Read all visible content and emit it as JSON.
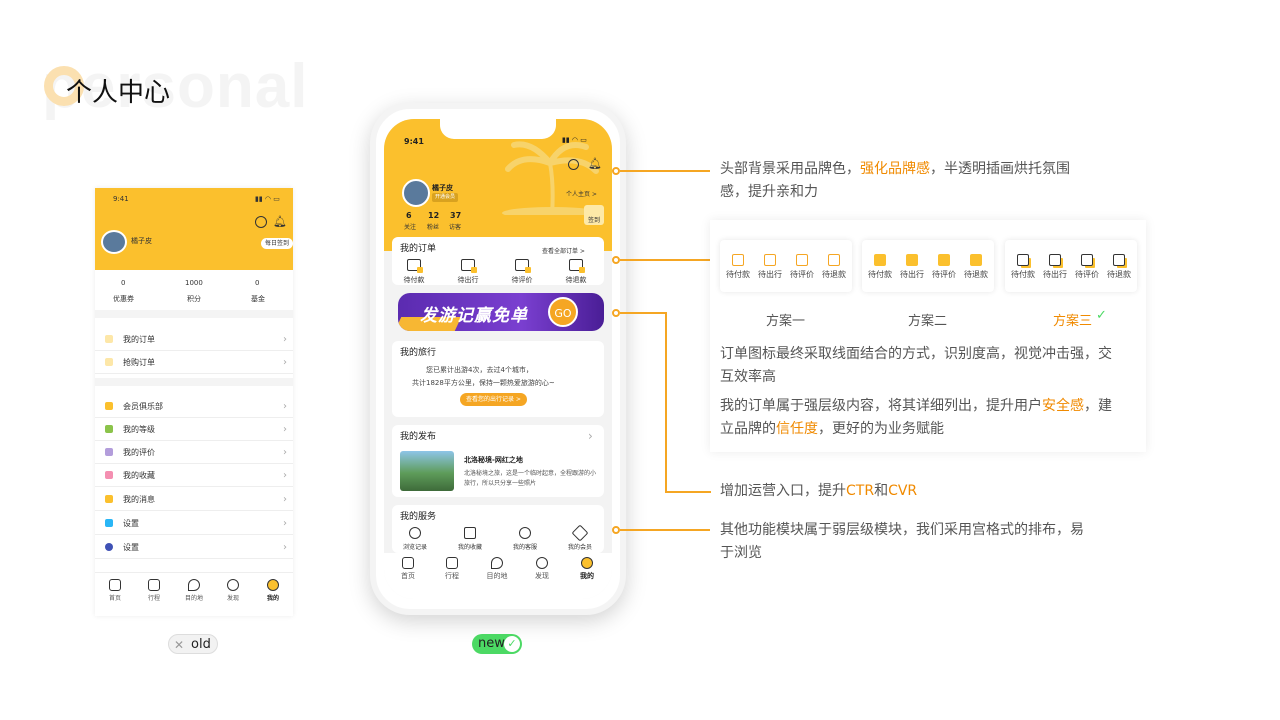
{
  "header": {
    "watermark": "personal",
    "title": "个人中心"
  },
  "old": {
    "time": "9:41",
    "username": "橘子皮",
    "checkin": "每日签到",
    "stats": [
      {
        "value": "0",
        "label": "优惠券"
      },
      {
        "value": "1000",
        "label": "积分"
      },
      {
        "value": "0",
        "label": "基金"
      }
    ],
    "rows1": [
      "我的订单",
      "抢购订单"
    ],
    "rows2": [
      "会员俱乐部",
      "我的等级",
      "我的评价",
      "我的收藏",
      "我的消息",
      "设置",
      "设置"
    ],
    "tabs": [
      "首页",
      "行程",
      "目的地",
      "发现",
      "我的"
    ],
    "tag": "old"
  },
  "new": {
    "time": "9:41",
    "username": "橘子皮",
    "member": "开通会员",
    "homepage": "个人主页 >",
    "signin": "签到",
    "stats": [
      {
        "value": "6",
        "label": "关注"
      },
      {
        "value": "12",
        "label": "粉丝"
      },
      {
        "value": "37",
        "label": "访客"
      }
    ],
    "orders": {
      "title": "我的订单",
      "all": "查看全部订单 >",
      "items": [
        "待付款",
        "待出行",
        "待评价",
        "待退款"
      ]
    },
    "banner": {
      "text": "发游记赢免单",
      "go": "GO"
    },
    "trip": {
      "title": "我的旅行",
      "line1": "您已累计出游4次，去过4个城市，",
      "line2": "共计1828平方公里，保持一颗热爱旅游的心~",
      "btn": "查看您的出行记录 >"
    },
    "publish": {
      "title": "我的发布",
      "post_title": "北洛秘境-网红之地",
      "post_body": "北洛秘境之旅，这是一个临时起意，全程跟游的小旅行，所以只分享一些照片"
    },
    "services": {
      "title": "我的服务",
      "items": [
        "浏览记录",
        "我的收藏",
        "我的客服",
        "我的会员"
      ]
    },
    "tabs": [
      "首页",
      "行程",
      "目的地",
      "发现",
      "我的"
    ],
    "tag": "new"
  },
  "annotations": {
    "a1_pre": "头部背景采用品牌色，",
    "a1_hl": "强化品牌感",
    "a1_post": "，半透明插画烘托氛围",
    "a1_line2": "感，提升亲和力",
    "schemes": [
      {
        "label": "方案一",
        "items": [
          "待付款",
          "待出行",
          "待评价",
          "待退款"
        ]
      },
      {
        "label": "方案二",
        "items": [
          "待付款",
          "待出行",
          "待评价",
          "待退款"
        ]
      },
      {
        "label": "方案三",
        "items": [
          "待付款",
          "待出行",
          "待评价",
          "待退款"
        ]
      }
    ],
    "p1_l1": "订单图标最终采取线面结合的方式，识别度高，视觉冲击强，交",
    "p1_l2": "互效率高",
    "p2_l1_pre": "我的订单属于强层级内容，将其详细列出，提升用户",
    "p2_l1_hl": "安全感",
    "p2_l1_post": "，建",
    "p2_l2_pre": "立品牌的",
    "p2_l2_hl": "信任度",
    "p2_l2_post": "，更好的为业务赋能",
    "a3_pre": "增加运营入口，提升",
    "a3_hl1": "CTR",
    "a3_mid": "和",
    "a3_hl2": "CVR",
    "a4_l1": "其他功能模块属于弱层级模块，我们采用宫格式的排布，易",
    "a4_l2": "于浏览"
  },
  "colors": {
    "brand": "#fbc02d",
    "accent": "#f08a00",
    "check": "#4cd964"
  }
}
